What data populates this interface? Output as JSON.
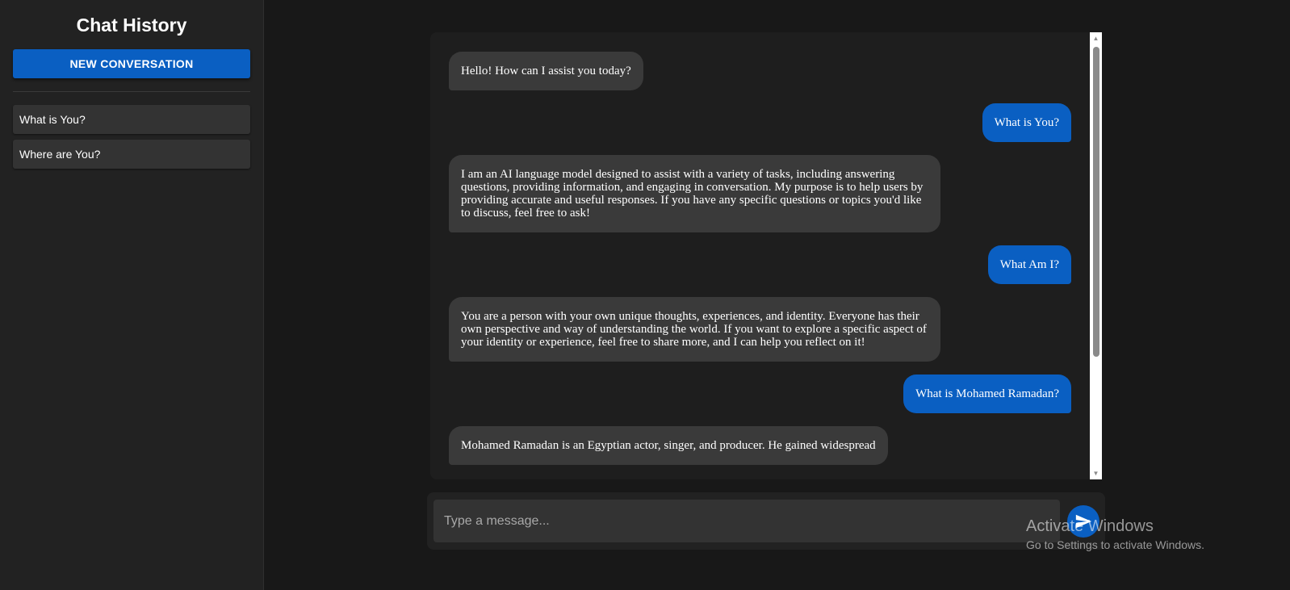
{
  "sidebar": {
    "title": "Chat History",
    "new_conversation_label": "NEW CONVERSATION",
    "history": [
      {
        "label": "What is You?"
      },
      {
        "label": "Where are You?"
      }
    ]
  },
  "messages": [
    {
      "role": "bot",
      "text": "Hello! How can I assist you today?"
    },
    {
      "role": "user",
      "text": "What is You?"
    },
    {
      "role": "bot",
      "text": "I am an AI language model designed to assist with a variety of tasks, including answering questions, providing information, and engaging in conversation. My purpose is to help users by providing accurate and useful responses. If you have any specific questions or topics you'd like to discuss, feel free to ask!"
    },
    {
      "role": "user",
      "text": "What Am I?"
    },
    {
      "role": "bot",
      "text": "You are a person with your own unique thoughts, experiences, and identity. Everyone has their own perspective and way of understanding the world. If you want to explore a specific aspect of your identity or experience, feel free to share more, and I can help you reflect on it!"
    },
    {
      "role": "user",
      "text": "What is Mohamed Ramadan?"
    },
    {
      "role": "bot",
      "text": "Mohamed Ramadan is an Egyptian actor, singer, and producer. He gained widespread"
    }
  ],
  "composer": {
    "placeholder": "Type a message..."
  },
  "watermark": {
    "title": "Activate Windows",
    "subtitle": "Go to Settings to activate Windows."
  },
  "colors": {
    "accent": "#0a5fc2",
    "bot_bubble": "#3a3a3a",
    "background": "#181818"
  }
}
